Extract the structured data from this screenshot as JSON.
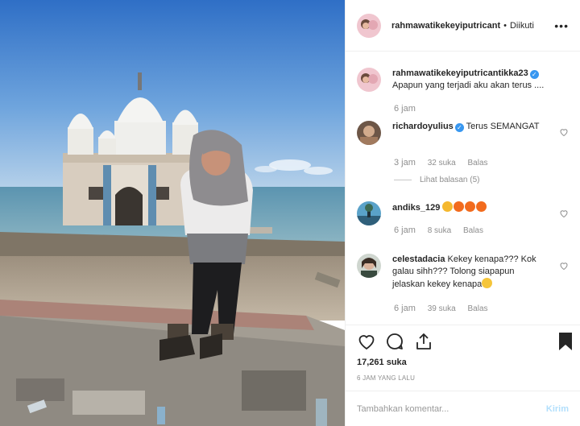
{
  "post": {
    "author": "rahmawatikekeyiputricant",
    "separator": "•",
    "follow_status": "Diikuti",
    "more_icon": "more-options-icon"
  },
  "caption": {
    "user": "rahmawatikekeyiputricantikka23",
    "text": "Apapun yang terjadi aku akan terus ....",
    "time": "6 jam"
  },
  "comments": [
    {
      "user": "richardoyulius",
      "text": "Terus SEMANGAT",
      "time": "3 jam",
      "likes": "32 suka",
      "reply": "Balas"
    },
    {
      "user": "andiks_129",
      "text": "",
      "emoji": [
        "clap",
        "fire",
        "fire",
        "fire"
      ],
      "time": "6 jam",
      "likes": "8 suka",
      "reply": "Balas"
    },
    {
      "user": "celestadacia",
      "text": "Kekey kenapa??? Kok galau sihh??? Tolong siapapun jelaskan kekey kenapa",
      "emoji": [
        "crying"
      ],
      "time": "6 jam",
      "likes": "39 suka",
      "reply": "Balas"
    }
  ],
  "view_replies": "Lihat balasan (5)",
  "likes_total": "17,261 suka",
  "posted_ago": "6 JAM YANG LALU",
  "add_comment": {
    "placeholder": "Tambahkan komentar...",
    "send_label": "Kirim"
  },
  "colors": {
    "verified": "#3897f0",
    "muted": "#8e8e8e",
    "send_disabled": "#b2dffc"
  }
}
